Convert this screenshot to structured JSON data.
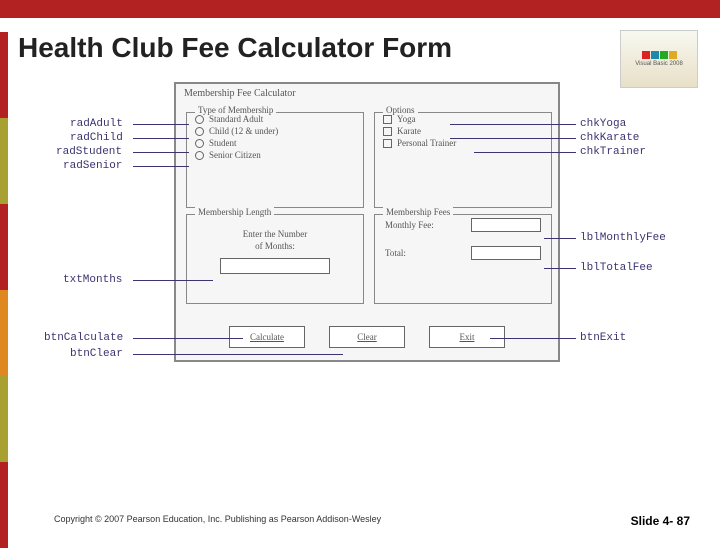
{
  "title": "Health Club Fee Calculator Form",
  "logo_text": "Visual Basic 2008",
  "mock": {
    "window_title": "Membership Fee Calculator",
    "groups": {
      "type": {
        "label": "Type of Membership",
        "options": [
          "Standard Adult",
          "Child (12 & under)",
          "Student",
          "Senior Citizen"
        ]
      },
      "opts": {
        "label": "Options",
        "options": [
          "Yoga",
          "Karate",
          "Personal Trainer"
        ]
      },
      "len": {
        "label": "Membership Length",
        "prompt1": "Enter the Number",
        "prompt2": "of Months:"
      },
      "fees": {
        "label": "Membership Fees",
        "monthly": "Monthly Fee:",
        "total": "Total:"
      }
    },
    "buttons": {
      "calc": "Calculate",
      "clear": "Clear",
      "exit": "Exit"
    }
  },
  "callouts": {
    "radAdult": "radAdult",
    "radChild": "radChild",
    "radStudent": "radStudent",
    "radSenior": "radSenior",
    "txtMonths": "txtMonths",
    "btnCalculate": "btnCalculate",
    "btnClear": "btnClear",
    "chkYoga": "chkYoga",
    "chkKarate": "chkKarate",
    "chkTrainer": "chkTrainer",
    "lblMonthlyFee": "lblMonthlyFee",
    "lblTotalFee": "lblTotalFee",
    "btnExit": "btnExit"
  },
  "footer": {
    "copyright": "Copyright © 2007 Pearson Education, Inc. Publishing as Pearson Addison-Wesley",
    "slide": "Slide 4- 87"
  }
}
